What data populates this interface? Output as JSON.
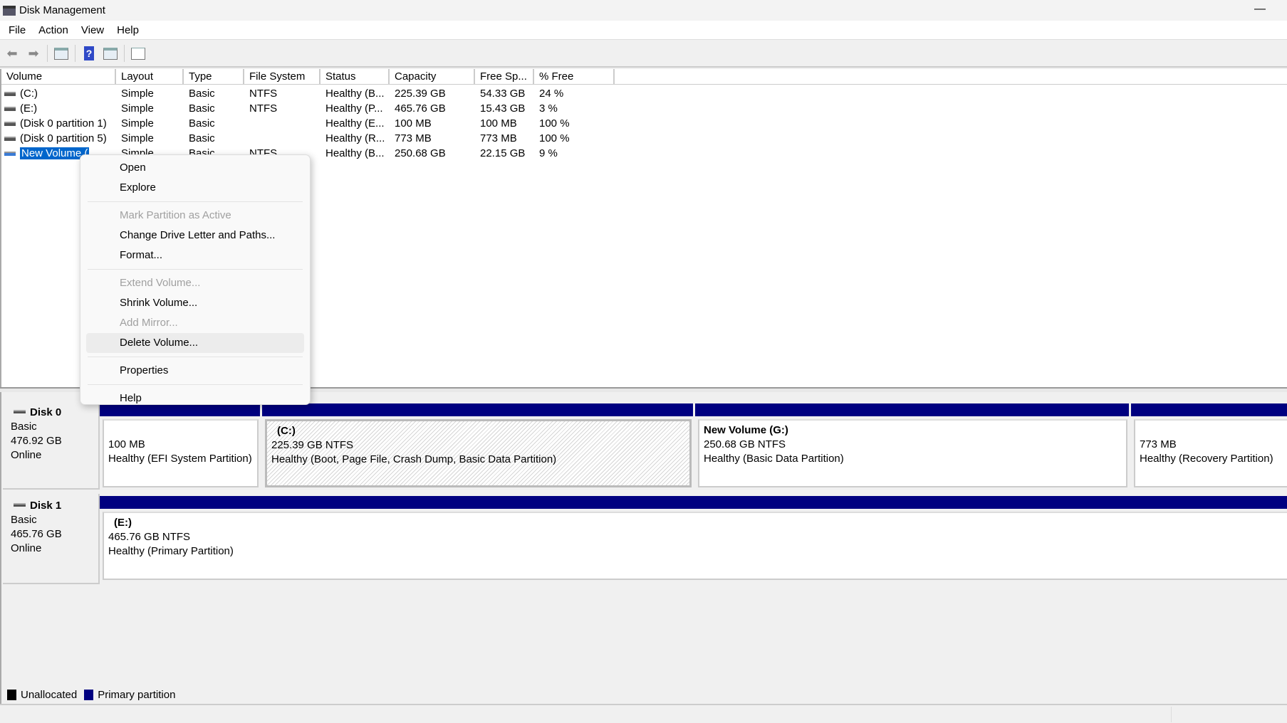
{
  "window": {
    "title": "Disk Management",
    "minimize": "—"
  },
  "menu": [
    "File",
    "Action",
    "View",
    "Help"
  ],
  "toolbar": {
    "icons": [
      "back-arrow-icon",
      "forward-arrow-icon",
      "show-hide-console-tree-icon",
      "help-icon",
      "show-action-pane-icon",
      "properties-icon"
    ]
  },
  "volume_list": {
    "columns": [
      "Volume",
      "Layout",
      "Type",
      "File System",
      "Status",
      "Capacity",
      "Free Sp...",
      "% Free"
    ],
    "rows": [
      {
        "volume": "(C:)",
        "layout": "Simple",
        "type": "Basic",
        "fs": "NTFS",
        "status": "Healthy (B...",
        "capacity": "225.39 GB",
        "free": "54.33 GB",
        "pct": "24 %"
      },
      {
        "volume": "(E:)",
        "layout": "Simple",
        "type": "Basic",
        "fs": "NTFS",
        "status": "Healthy (P...",
        "capacity": "465.76 GB",
        "free": "15.43 GB",
        "pct": "3 %"
      },
      {
        "volume": "(Disk 0 partition 1)",
        "layout": "Simple",
        "type": "Basic",
        "fs": "",
        "status": "Healthy (E...",
        "capacity": "100 MB",
        "free": "100 MB",
        "pct": "100 %"
      },
      {
        "volume": "(Disk 0 partition 5)",
        "layout": "Simple",
        "type": "Basic",
        "fs": "",
        "status": "Healthy (R...",
        "capacity": "773 MB",
        "free": "773 MB",
        "pct": "100 %"
      },
      {
        "volume": "New Volume (",
        "layout": "Simple",
        "type": "Basic",
        "fs": "NTFS",
        "status": "Healthy (B...",
        "capacity": "250.68 GB",
        "free": "22.15 GB",
        "pct": "9 %",
        "selected": true
      }
    ]
  },
  "context_menu": {
    "items": [
      {
        "label": "Open",
        "enabled": true
      },
      {
        "label": "Explore",
        "enabled": true
      },
      {
        "label": "Mark Partition as Active",
        "enabled": false
      },
      {
        "label": "Change Drive Letter and Paths...",
        "enabled": true
      },
      {
        "label": "Format...",
        "enabled": true
      },
      {
        "label": "Extend Volume...",
        "enabled": false
      },
      {
        "label": "Shrink Volume...",
        "enabled": true
      },
      {
        "label": "Add Mirror...",
        "enabled": false
      },
      {
        "label": "Delete Volume...",
        "enabled": true,
        "hovered": true
      },
      {
        "label": "Properties",
        "enabled": true
      },
      {
        "label": "Help",
        "enabled": true
      }
    ]
  },
  "disks": [
    {
      "name": "Disk 0",
      "type": "Basic",
      "size": "476.92 GB",
      "status": "Online",
      "partitions": [
        {
          "name": "",
          "size": "100 MB",
          "status": "Healthy (EFI System Partition)"
        },
        {
          "name": "(C:)",
          "size": "225.39 GB NTFS",
          "status": "Healthy (Boot, Page File, Crash Dump, Basic Data Partition)"
        },
        {
          "name": "New Volume  (G:)",
          "size": "250.68 GB NTFS",
          "status": "Healthy (Basic Data Partition)"
        },
        {
          "name": "",
          "size": "773 MB",
          "status": "Healthy (Recovery Partition)"
        }
      ]
    },
    {
      "name": "Disk 1",
      "type": "Basic",
      "size": "465.76 GB",
      "status": "Online",
      "partitions": [
        {
          "name": "(E:)",
          "size": "465.76 GB NTFS",
          "status": "Healthy (Primary Partition)"
        }
      ]
    }
  ],
  "legend": [
    {
      "label": "Unallocated",
      "color": "#000000"
    },
    {
      "label": "Primary partition",
      "color": "#000080"
    }
  ],
  "colors": {
    "primary_partition": "#000080",
    "selection": "#0066cc"
  }
}
